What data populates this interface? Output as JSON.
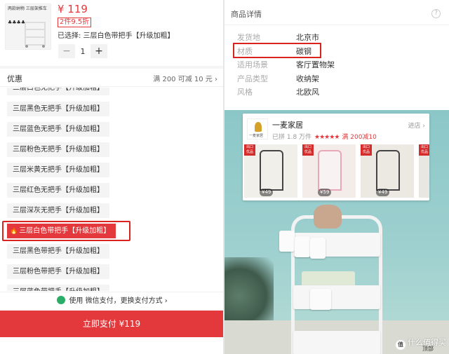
{
  "product": {
    "price": "¥ 119",
    "discount": "2件9.5折",
    "selected_label": "已选择: 三层白色带把手【升级加粗】",
    "quantity": "1",
    "minus": "−",
    "plus": "+",
    "thumb_text": "两款纳物 三层架推车",
    "thumb_icons": "♣♣♣♣"
  },
  "promo": {
    "label": "优惠",
    "value": "满 200 可减 10 元 ›"
  },
  "variants": [
    "三层白色无把手【升级加粗】",
    "三层黑色无把手【升级加粗】",
    "三层蓝色无把手【升级加粗】",
    "三层粉色无把手【升级加粗】",
    "三层米黄无把手【升级加粗】",
    "三层红色无把手【升级加粗】",
    "三层深灰无把手【升级加粗】",
    "三层白色带把手【升级加粗】",
    "三层黑色带把手【升级加粗】",
    "三层粉色带把手【升级加粗】",
    "三层蓝色带把手【升级加粗】"
  ],
  "selected_variant_index": 7,
  "payment": {
    "info": "使用 微信支付，更换支付方式 ›",
    "button": "立即支付 ¥119"
  },
  "details": {
    "title": "商品详情",
    "help": "?",
    "specs": [
      {
        "k": "发货地",
        "v": "北京市"
      },
      {
        "k": "材质",
        "v": "碳钢"
      },
      {
        "k": "适用场景",
        "v": "客厅置物架"
      },
      {
        "k": "产品类型",
        "v": "收纳架"
      },
      {
        "k": "风格",
        "v": "北欧风"
      }
    ]
  },
  "shop": {
    "name": "一麦家居",
    "logo_caption": "一麦家居",
    "sales": "已拼 1.8 万件",
    "stars": "★★★★★",
    "promo": "满 200减10",
    "enter": "进店 ›",
    "tag": "出口 优品",
    "counts": [
      "¥49",
      "¥59",
      "¥49",
      ""
    ]
  },
  "watermark": {
    "icon": "值",
    "text": "什么值得买",
    "top": "顶部"
  },
  "colors": {
    "accent": "#e4393c",
    "wechat": "#2aae67"
  }
}
